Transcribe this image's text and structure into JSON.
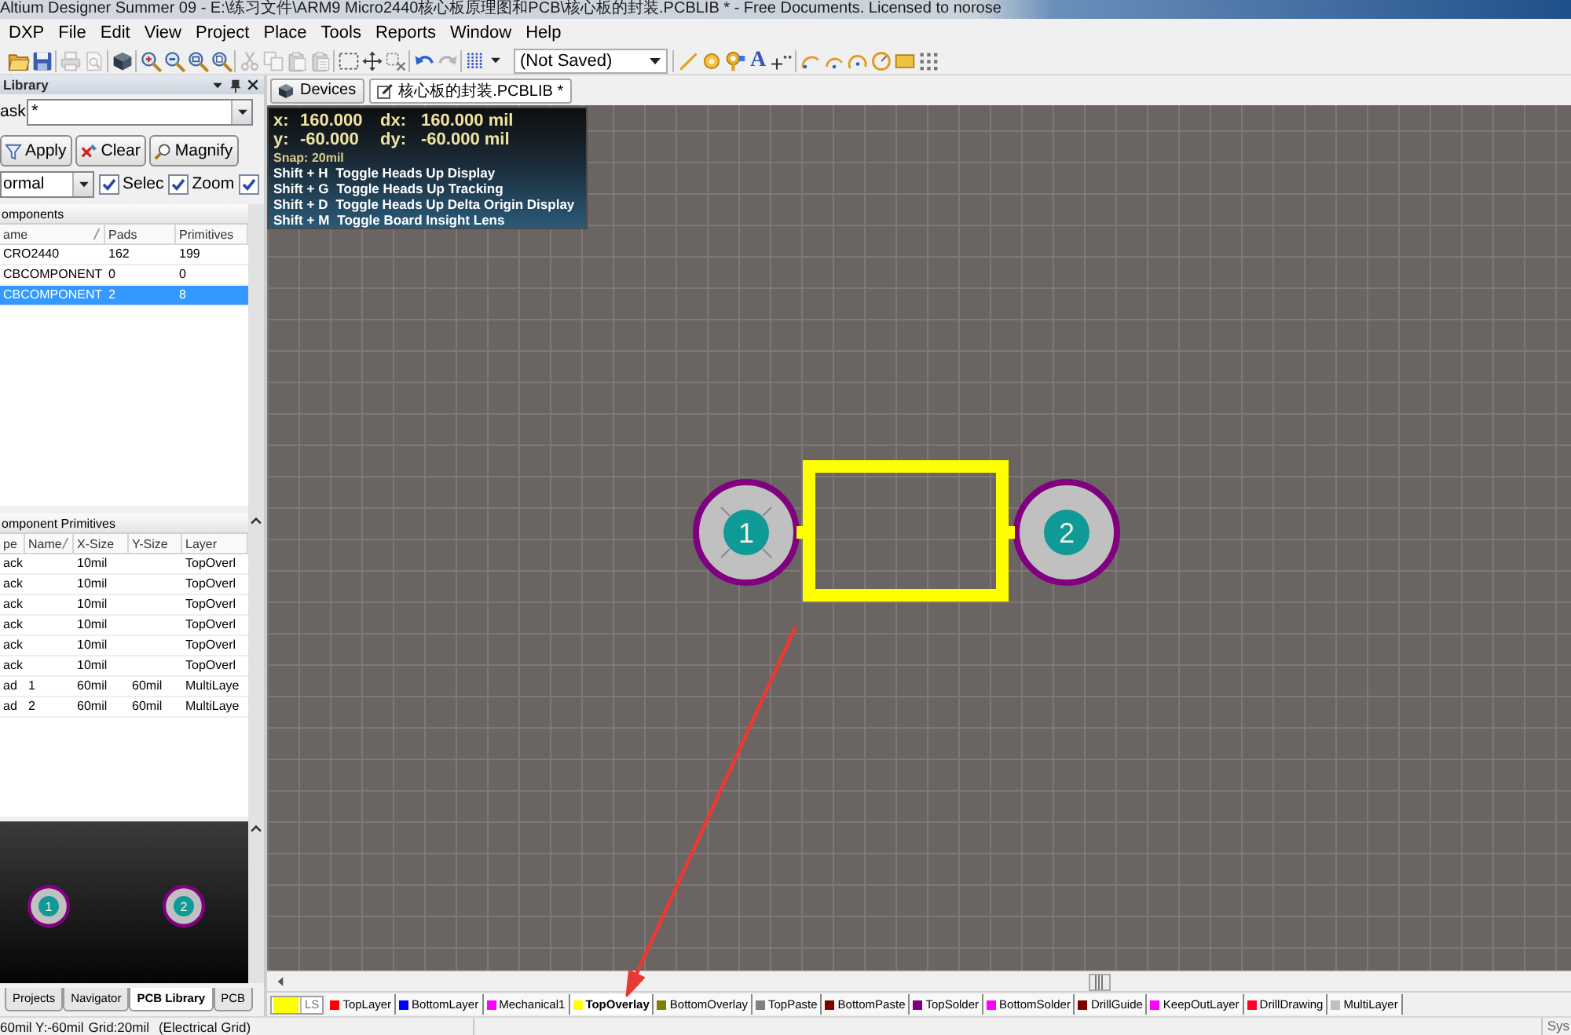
{
  "window": {
    "title": "Altium Designer Summer 09 - E:\\练习文件\\ARM9 Micro2440核心板原理图和PCB\\核心板的封装.PCBLIB * - Free Documents. Licensed to norose"
  },
  "menu": [
    "DXP",
    "File",
    "Edit",
    "View",
    "Project",
    "Place",
    "Tools",
    "Reports",
    "Window",
    "Help"
  ],
  "toolbar": [
    {
      "kind": "open",
      "disabled": false
    },
    {
      "kind": "save",
      "disabled": false
    },
    {
      "kind": "separator"
    },
    {
      "kind": "print",
      "disabled": true
    },
    {
      "kind": "preview",
      "disabled": true
    },
    {
      "kind": "separator"
    },
    {
      "kind": "board3d",
      "disabled": false
    },
    {
      "kind": "separator"
    },
    {
      "kind": "zoomin",
      "disabled": false
    },
    {
      "kind": "zoomout",
      "disabled": false
    },
    {
      "kind": "zoomarea",
      "disabled": false
    },
    {
      "kind": "zoomselected",
      "disabled": false
    },
    {
      "kind": "separator"
    },
    {
      "kind": "cut",
      "disabled": true
    },
    {
      "kind": "copy",
      "disabled": true
    },
    {
      "kind": "paste",
      "disabled": true
    },
    {
      "kind": "pastespecial",
      "disabled": true
    },
    {
      "kind": "separator"
    },
    {
      "kind": "selectarea",
      "disabled": false
    },
    {
      "kind": "move",
      "disabled": false
    },
    {
      "kind": "deselect",
      "disabled": false
    },
    {
      "kind": "separator"
    },
    {
      "kind": "undo",
      "disabled": false
    },
    {
      "kind": "redo",
      "disabled": true
    },
    {
      "kind": "separator"
    },
    {
      "kind": "grid",
      "disabled": false
    },
    {
      "kind": "combo",
      "value": "(Not Saved)"
    },
    {
      "kind": "separator"
    },
    {
      "kind": "line",
      "disabled": false
    },
    {
      "kind": "pad",
      "disabled": false
    },
    {
      "kind": "via",
      "disabled": false
    },
    {
      "kind": "text",
      "glyph": "A",
      "disabled": false
    },
    {
      "kind": "coordinate",
      "disabled": false
    },
    {
      "kind": "separator"
    },
    {
      "kind": "arcedge",
      "disabled": false
    },
    {
      "kind": "arccenter",
      "disabled": false
    },
    {
      "kind": "arcany",
      "disabled": false
    },
    {
      "kind": "circle",
      "disabled": false
    },
    {
      "kind": "fill",
      "disabled": false
    },
    {
      "kind": "array",
      "disabled": false
    }
  ],
  "library": {
    "title": "Library",
    "mask": {
      "label": "ask",
      "value": "*"
    },
    "buttons": [
      {
        "kind": "apply",
        "label": "Apply"
      },
      {
        "kind": "clear",
        "label": "Clear"
      },
      {
        "kind": "magnify",
        "label": "Magnify"
      }
    ],
    "mode": "ormal",
    "filters": [
      {
        "label": "Selec",
        "checked": true
      },
      {
        "label": "Zoom",
        "checked": true
      },
      {
        "checked": true
      }
    ],
    "components": {
      "title": "omponents",
      "columns": [
        {
          "label": "ame",
          "sorted": true
        },
        {
          "label": "Pads",
          "sorted": false
        },
        {
          "label": "Primitives",
          "sorted": false
        }
      ],
      "rows": [
        {
          "name": "CRO2440",
          "pads": "162",
          "primitives": "199",
          "selected": false
        },
        {
          "name": "CBCOMPONENT",
          "pads": "0",
          "primitives": "0",
          "selected": false
        },
        {
          "name": "CBCOMPONENT",
          "pads": "2",
          "primitives": "8",
          "selected": true
        }
      ]
    },
    "primitives": {
      "title": "omponent Primitives",
      "columns": [
        {
          "label": "pe",
          "sorted": false
        },
        {
          "label": "Name",
          "sorted": true
        },
        {
          "label": "X-Size",
          "sorted": false
        },
        {
          "label": "Y-Size",
          "sorted": false
        },
        {
          "label": "Layer",
          "sorted": false
        }
      ],
      "rows": [
        {
          "type": "ack",
          "x_size": "10mil",
          "layer": "TopOverl",
          "selected": false
        },
        {
          "type": "ack",
          "x_size": "10mil",
          "layer": "TopOverl",
          "selected": false
        },
        {
          "type": "ack",
          "x_size": "10mil",
          "layer": "TopOverl",
          "selected": false
        },
        {
          "type": "ack",
          "x_size": "10mil",
          "layer": "TopOverl",
          "selected": false
        },
        {
          "type": "ack",
          "x_size": "10mil",
          "layer": "TopOverl",
          "selected": false
        },
        {
          "type": "ack",
          "x_size": "10mil",
          "layer": "TopOverl",
          "selected": false
        },
        {
          "type": "ad",
          "name": "1",
          "x_size": "60mil",
          "y_size": "60mil",
          "layer": "MultiLaye",
          "selected": false
        },
        {
          "type": "ad",
          "name": "2",
          "x_size": "60mil",
          "y_size": "60mil",
          "layer": "MultiLaye",
          "selected": false
        }
      ]
    },
    "preview": {
      "pads": [
        {
          "number": "1"
        },
        {
          "number": "2"
        }
      ]
    },
    "tabs": [
      {
        "label": "Projects",
        "selected": false
      },
      {
        "label": "Navigator",
        "selected": false
      },
      {
        "label": "PCB Library",
        "selected": true
      },
      {
        "label": "PCB",
        "selected": false
      }
    ]
  },
  "documents": [
    {
      "kind": "panel",
      "label": "Devices",
      "selected": false
    },
    {
      "kind": "document",
      "label": "核心板的封装.PCBLIB *",
      "selected": true
    }
  ],
  "hud": {
    "coordinates": [
      {
        "axis": "x:",
        "value": "160.000",
        "delta_axis": "dx:",
        "delta": "160.000 mil"
      },
      {
        "axis": "y:",
        "value": "-60.000",
        "delta_axis": "dy:",
        "delta": "-60.000 mil"
      }
    ],
    "snap": "Snap: 20mil",
    "shortcuts": [
      {
        "keys": "Shift + H",
        "action": "Toggle Heads Up Display"
      },
      {
        "keys": "Shift + G",
        "action": "Toggle Heads Up Tracking"
      },
      {
        "keys": "Shift + D",
        "action": "Toggle Heads Up Delta Origin Display"
      },
      {
        "keys": "Shift + M",
        "action": "Toggle Board Insight Lens"
      }
    ]
  },
  "canvas": {
    "pads": [
      {
        "number": "1"
      },
      {
        "number": "2"
      }
    ]
  },
  "layers": {
    "set_label": "LS",
    "items": [
      {
        "name": "TopLayer",
        "color": "#ff0000",
        "selected": false
      },
      {
        "name": "BottomLayer",
        "color": "#0000ff",
        "selected": false
      },
      {
        "name": "Mechanical1",
        "color": "#ff00ff",
        "selected": false
      },
      {
        "name": "TopOverlay",
        "color": "#ffff00",
        "selected": true
      },
      {
        "name": "BottomOverlay",
        "color": "#808000",
        "selected": false
      },
      {
        "name": "TopPaste",
        "color": "#808080",
        "selected": false
      },
      {
        "name": "BottomPaste",
        "color": "#800000",
        "selected": false
      },
      {
        "name": "TopSolder",
        "color": "#800080",
        "selected": false
      },
      {
        "name": "BottomSolder",
        "color": "#ff00ff",
        "selected": false
      },
      {
        "name": "DrillGuide",
        "color": "#800000",
        "selected": false
      },
      {
        "name": "KeepOutLayer",
        "color": "#ff00ff",
        "selected": false
      },
      {
        "name": "DrillDrawing",
        "color": "#ff002a",
        "selected": false
      },
      {
        "name": "MultiLayer",
        "color": "#c0c0c0",
        "selected": false
      }
    ]
  },
  "status": {
    "position": "60mil Y:-60mil",
    "grid": "Grid:20mil",
    "grid_mode": "(Electrical Grid)",
    "system": "Sys"
  }
}
